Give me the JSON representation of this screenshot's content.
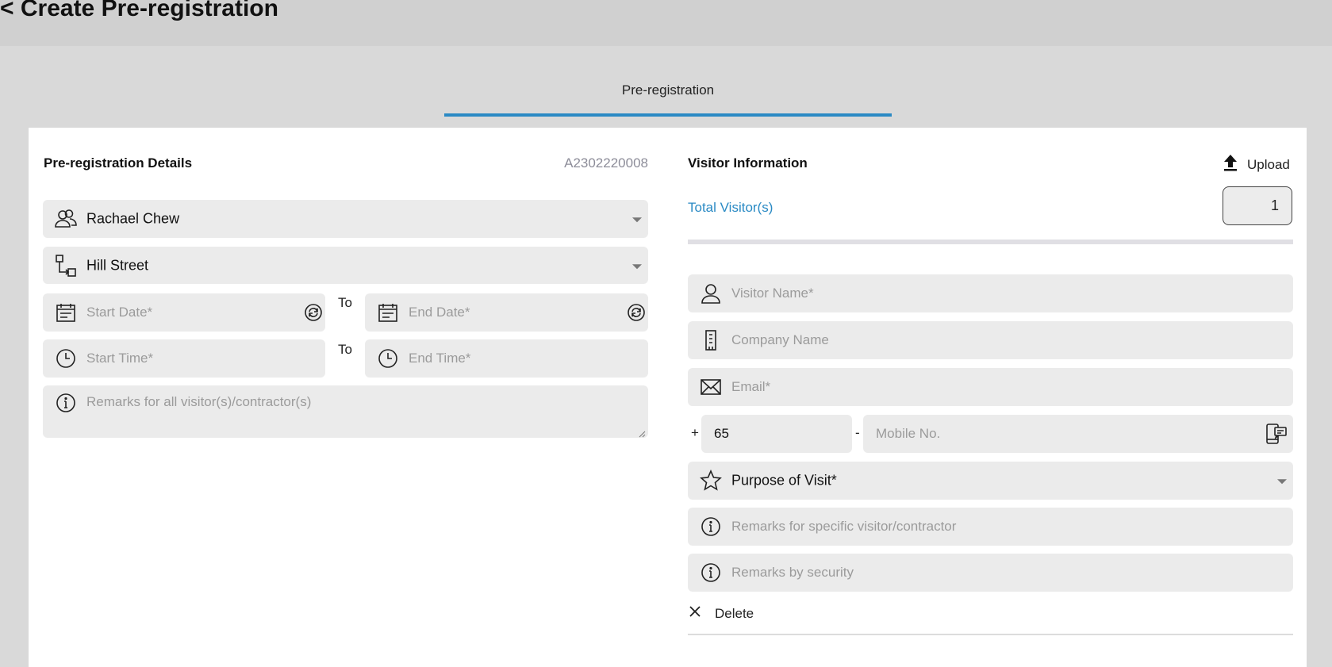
{
  "header": {
    "title": "< Create Pre-registration"
  },
  "tabs": [
    {
      "label": "Pre-registration",
      "active": true
    }
  ],
  "accent_color": "#2a8ac4",
  "details": {
    "title": "Pre-registration Details",
    "reference": "A2302220008",
    "host": {
      "value": "Rachael Chew",
      "icon": "users-icon"
    },
    "location": {
      "value": "Hill Street",
      "icon": "hierarchy-icon"
    },
    "start_date": {
      "placeholder": "Start Date*"
    },
    "end_date": {
      "placeholder": "End Date*"
    },
    "start_time": {
      "placeholder": "Start Time*"
    },
    "end_time": {
      "placeholder": "End Time*"
    },
    "to_label": "To",
    "remarks_all": {
      "placeholder": "Remarks for all visitor(s)/contractor(s)"
    }
  },
  "visitor": {
    "title": "Visitor Information",
    "upload_label": "Upload",
    "total_label": "Total Visitor(s)",
    "total_value": "1",
    "name": {
      "placeholder": "Visitor Name*"
    },
    "company": {
      "placeholder": "Company Name"
    },
    "email": {
      "placeholder": "Email*"
    },
    "phone_plus": "+",
    "country_code": "65",
    "phone_dash": "-",
    "mobile": {
      "placeholder": "Mobile No."
    },
    "purpose": {
      "value": "Purpose of Visit*"
    },
    "remarks_specific": {
      "placeholder": "Remarks for specific visitor/contractor"
    },
    "remarks_security": {
      "placeholder": "Remarks by security"
    },
    "delete_label": "Delete"
  }
}
